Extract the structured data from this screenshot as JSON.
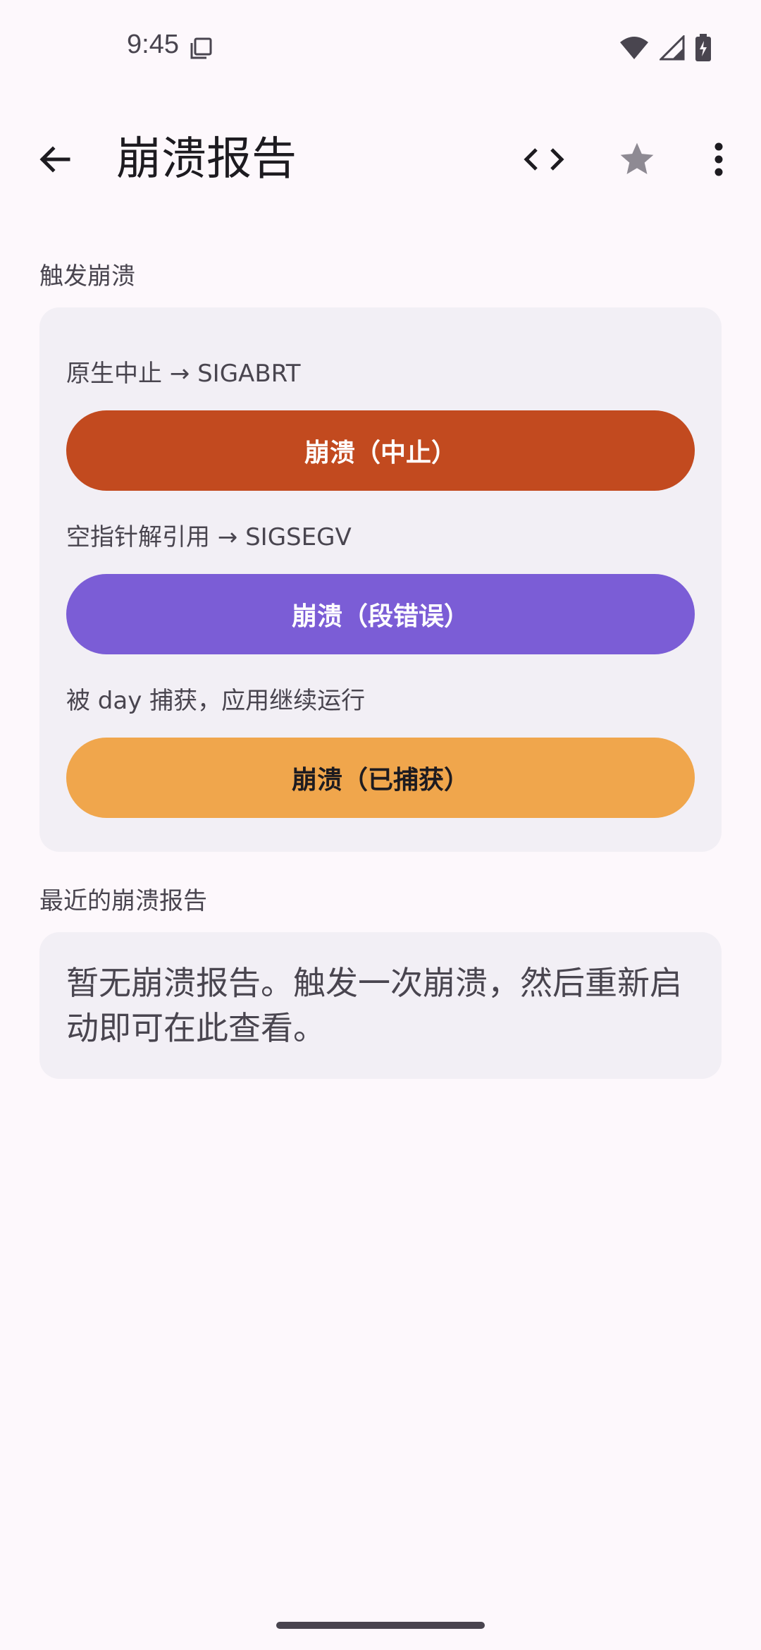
{
  "status_bar": {
    "time": "9:45",
    "icons": [
      "screen-record-icon",
      "wifi-icon",
      "cell-signal-icon",
      "battery-charging-icon"
    ]
  },
  "app_bar": {
    "title": "崩溃报告",
    "icons": [
      "arrow-back-icon",
      "code-icon",
      "star-icon",
      "more-vert-icon"
    ]
  },
  "trigger_section": {
    "label": "触发崩溃",
    "items": [
      {
        "description": "原生中止 → SIGABRT",
        "button_label": "崩溃（中止）",
        "color": "#c24a1f"
      },
      {
        "description": "空指针解引用 → SIGSEGV",
        "button_label": "崩溃（段错误）",
        "color": "#7b5dd6"
      },
      {
        "description": "被 day 捕获，应用继续运行",
        "button_label": "崩溃（已捕获）",
        "color": "#f0a64c"
      }
    ]
  },
  "reports_section": {
    "label": "最近的崩溃报告",
    "empty_text": "暂无崩溃报告。触发一次崩溃，然后重新启动即可在此查看。"
  }
}
